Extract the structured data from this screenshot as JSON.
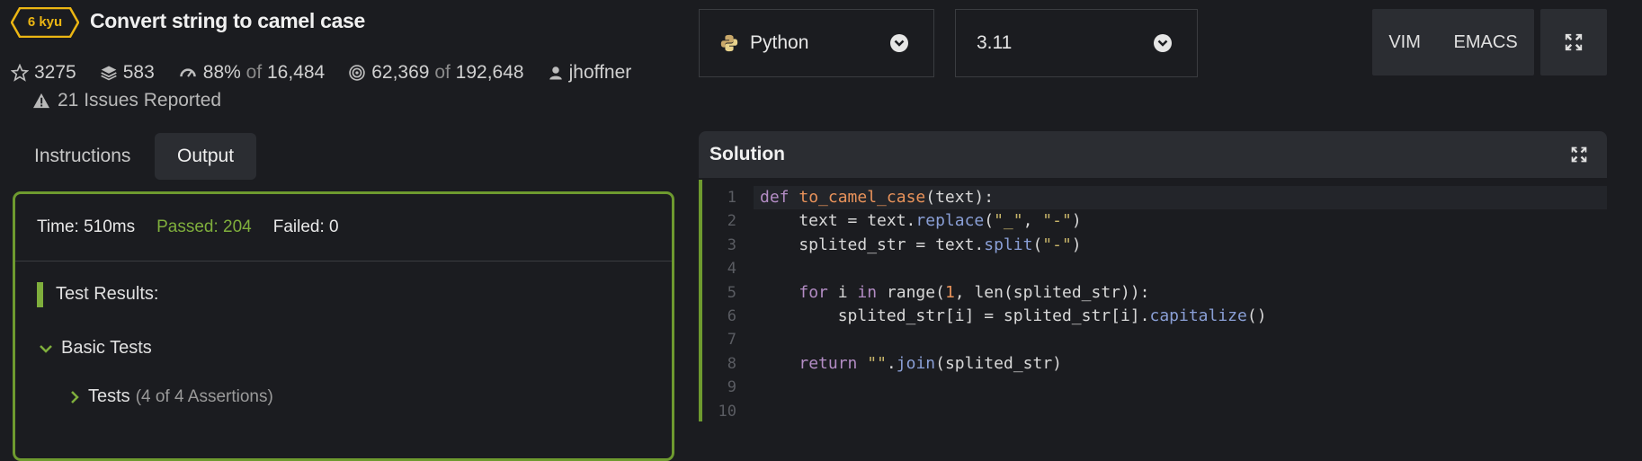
{
  "kata": {
    "rank": "6 kyu",
    "title": "Convert string to camel case",
    "stats": {
      "stars": "3275",
      "collections": "583",
      "satisfaction": "88%",
      "satisfaction_of": "of",
      "satisfaction_total": "16,484",
      "completed": "62,369",
      "completed_of": "of",
      "completed_total": "192,648",
      "author": "jhoffner"
    },
    "issues": "21 Issues Reported"
  },
  "tabs": [
    {
      "label": "Instructions"
    },
    {
      "label": "Output"
    }
  ],
  "output": {
    "time": "Time: 510ms",
    "passed": "Passed: 204",
    "failed": "Failed: 0",
    "results_heading": "Test Results:",
    "group": "Basic Tests",
    "subgroup": "Tests",
    "subgroup_note": "(4 of 4 Assertions)"
  },
  "language_select": {
    "value": "Python",
    "icon": "python-icon"
  },
  "version_select": {
    "value": "3.11"
  },
  "editor_modes": {
    "vim": "VIM",
    "emacs": "EMACS"
  },
  "solution": {
    "title": "Solution",
    "line_numbers": [
      "1",
      "2",
      "3",
      "4",
      "5",
      "6",
      "7",
      "8",
      "9",
      "10"
    ]
  },
  "colors": {
    "accent_green": "#7fae3c",
    "rank_yellow": "#ecb613",
    "background": "#1b1c20",
    "panel": "#2b2d32"
  }
}
